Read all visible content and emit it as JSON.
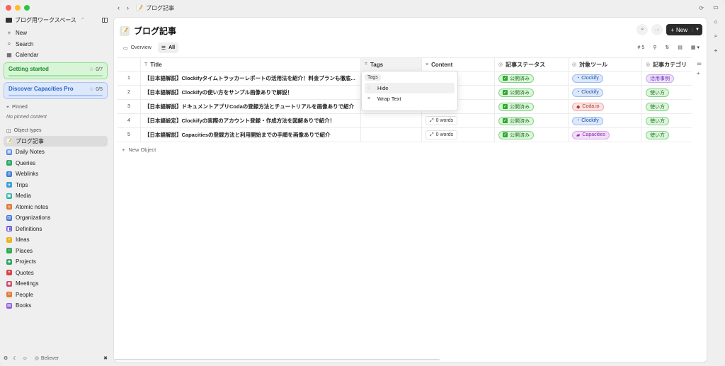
{
  "app": {
    "workspace": "ブログ用ワークスペース"
  },
  "nav": [
    {
      "label": "New",
      "icon": "plus-icon"
    },
    {
      "label": "Search",
      "icon": "search-icon"
    },
    {
      "label": "Calendar",
      "icon": "calendar-icon"
    }
  ],
  "cards": [
    {
      "label": "Getting started",
      "count": "0/7"
    },
    {
      "label": "Discover Capacities Pro",
      "count": "0/5"
    }
  ],
  "pinned": {
    "label": "Pinned",
    "empty": "No pinned content"
  },
  "object_types": {
    "label": "Object types",
    "items": [
      {
        "label": "ブログ記事",
        "color": "#e9dfc6",
        "glyph": "📝",
        "icon": "pencil-icon"
      },
      {
        "label": "Daily Notes",
        "color": "#4f83e6",
        "glyph": "▦",
        "icon": "calendar-icon"
      },
      {
        "label": "Queries",
        "color": "#31a86b",
        "glyph": "≡",
        "icon": "filter-icon"
      },
      {
        "label": "Weblinks",
        "color": "#3b7fd6",
        "glyph": "◎",
        "icon": "globe-icon"
      },
      {
        "label": "Trips",
        "color": "#3aa0d6",
        "glyph": "✈",
        "icon": "plane-icon"
      },
      {
        "label": "Media",
        "color": "#2bb3a0",
        "glyph": "▣",
        "icon": "image-icon"
      },
      {
        "label": "Atomic notes",
        "color": "#e07a3a",
        "glyph": "⚛",
        "icon": "atom-icon"
      },
      {
        "label": "Organizations",
        "color": "#3c6fd1",
        "glyph": "▥",
        "icon": "building-icon"
      },
      {
        "label": "Definitions",
        "color": "#6a5ad6",
        "glyph": "◧",
        "icon": "book-icon"
      },
      {
        "label": "Ideas",
        "color": "#e8b31e",
        "glyph": "✧",
        "icon": "lightbulb-icon"
      },
      {
        "label": "Places",
        "color": "#2fa84f",
        "glyph": "⌂",
        "icon": "pin-icon"
      },
      {
        "label": "Projects",
        "color": "#2ea566",
        "glyph": "◈",
        "icon": "folder-icon"
      },
      {
        "label": "Quotes",
        "color": "#d64545",
        "glyph": "❝",
        "icon": "quote-icon"
      },
      {
        "label": "Meetings",
        "color": "#d14a6e",
        "glyph": "◉",
        "icon": "people-icon"
      },
      {
        "label": "People",
        "color": "#e07a3a",
        "glyph": "☺",
        "icon": "person-icon"
      },
      {
        "label": "Books",
        "color": "#8a5ad6",
        "glyph": "▤",
        "icon": "books-icon"
      }
    ]
  },
  "bottom": {
    "badge": "Believer"
  },
  "breadcrumb": "ブログ記事",
  "page": {
    "title": "ブログ記事",
    "new_label": "New",
    "tabs": [
      {
        "label": "Overview",
        "selected": false
      },
      {
        "label": "All",
        "selected": true
      }
    ],
    "count": "5"
  },
  "table": {
    "columns": [
      "Title",
      "Tags",
      "Content",
      "記事ステータス",
      "対象ツール",
      "記事カテゴリ"
    ],
    "rows": [
      {
        "num": "1",
        "title": "【日本語解説】Clockifyタイムトラッカーレポートの活用法を紹介！料金プランも徹底...",
        "content": "",
        "status": "公開済み",
        "tool": "Clockify",
        "tool_kind": "tool",
        "category": "活用事例",
        "cat_kind": "case"
      },
      {
        "num": "2",
        "title": "【日本語解説】Clockifyの使い方をサンプル画像ありで解説！",
        "content": "",
        "status": "公開済み",
        "tool": "Clockify",
        "tool_kind": "tool",
        "category": "使い方",
        "cat_kind": "how"
      },
      {
        "num": "3",
        "title": "【日本語解説】ドキュメントアプリCodaの登録方法とチュートリアルを画像ありで紹介",
        "content": "",
        "status": "公開済み",
        "tool": "Coda.io",
        "tool_kind": "coda",
        "category": "使い方",
        "cat_kind": "how"
      },
      {
        "num": "4",
        "title": "【日本語設定】Clockifyの実際のアカウント登録・作成方法を図解ありで紹介！",
        "content": "0 words",
        "status": "公開済み",
        "tool": "Clockify",
        "tool_kind": "tool",
        "category": "使い方",
        "cat_kind": "how"
      },
      {
        "num": "5",
        "title": "【日本語解説】Capacitiesの登録方法と利用開始までの手順を画像ありで紹介",
        "content": "0 words",
        "status": "公開済み",
        "tool": "Capacities",
        "tool_kind": "cap",
        "category": "使い方",
        "cat_kind": "how"
      }
    ],
    "new_object": "New Object"
  },
  "menu": {
    "header": "Tags",
    "items": [
      "Hide",
      "Wrap Text"
    ]
  }
}
